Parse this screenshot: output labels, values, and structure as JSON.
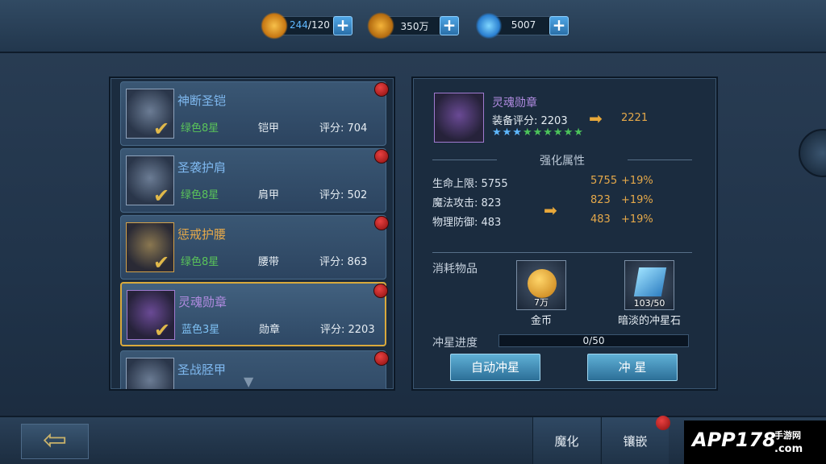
{
  "resources": {
    "energy": {
      "current": "244",
      "max": "/120",
      "icon": "energy-icon"
    },
    "gold": {
      "value": "350万",
      "icon": "gold-coin-icon"
    },
    "diamond": {
      "value": "5007",
      "icon": "diamond-icon"
    },
    "plus_label": "+"
  },
  "equipment_list": [
    {
      "name": "神断圣铠",
      "grade": "绿色8星",
      "slot": "铠甲",
      "score": "评分: 704",
      "equipped": true
    },
    {
      "name": "圣袭护肩",
      "grade": "绿色8星",
      "slot": "肩甲",
      "score": "评分: 502",
      "equipped": true
    },
    {
      "name": "惩戒护腰",
      "grade": "绿色8星",
      "slot": "腰带",
      "score": "评分: 863",
      "equipped": true
    },
    {
      "name": "灵魂勋章",
      "grade": "蓝色3星",
      "slot": "勋章",
      "score": "评分: 2203",
      "equipped": true,
      "selected": true
    },
    {
      "name": "圣战胫甲",
      "grade": "",
      "slot": "",
      "score": "",
      "equipped": false
    }
  ],
  "detail": {
    "name": "灵魂勋章",
    "score_label": "装备评分: 2203",
    "score_new": "2221",
    "stars_blue": "★★★",
    "stars_green": "★★★★★★",
    "section_title": "强化属性",
    "stats": [
      {
        "label": "生命上限: 5755",
        "new": "5755",
        "inc": "+19%"
      },
      {
        "label": "魔法攻击: 823",
        "new": "823",
        "inc": "+19%"
      },
      {
        "label": "物理防御: 483",
        "new": "483",
        "inc": "+19%"
      }
    ],
    "consume_label": "消耗物品",
    "materials": [
      {
        "name": "金币",
        "count": "7万",
        "icon": "gold-coin-icon"
      },
      {
        "name": "暗淡的冲星石",
        "count": "103/50",
        "icon": "star-stone-icon"
      }
    ],
    "progress_label": "冲星进度",
    "progress_text": "0/50",
    "progress_fraction": 0,
    "auto_button": "自动冲星",
    "star_button": "冲 星"
  },
  "bottom": {
    "back_icon": "back-arrow-icon",
    "tabs": [
      {
        "label": "魔化"
      },
      {
        "label": "镶嵌"
      }
    ]
  },
  "watermark": {
    "brand": "APP178",
    "line1": "手游网",
    "line2": ".com"
  }
}
